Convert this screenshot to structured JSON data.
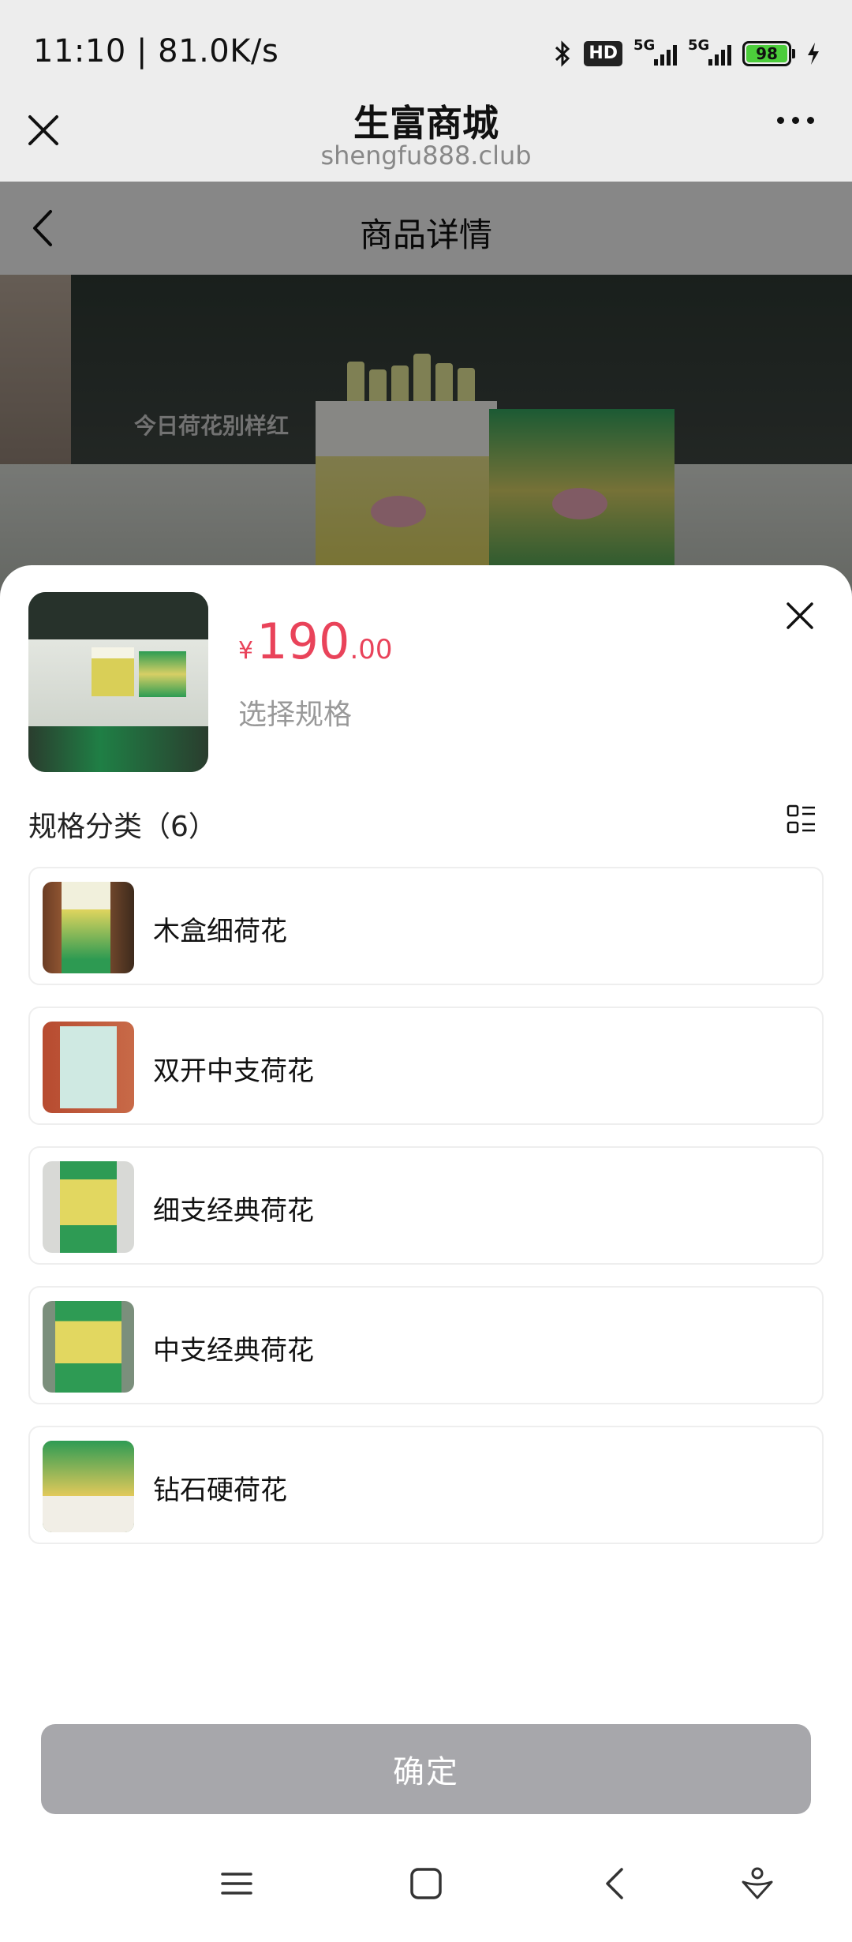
{
  "status_bar": {
    "time_speed": "11:10 | 81.0K/s",
    "hd_label": "HD",
    "signal1_label": "5G",
    "signal2_label": "5G",
    "battery": "98"
  },
  "mini_program": {
    "title": "生富商城",
    "url": "shengfu888.club"
  },
  "page": {
    "title": "商品详情",
    "hero_slogan": "今日荷花别样红"
  },
  "sheet": {
    "price_currency": "¥",
    "price_integer": "190",
    "price_decimal": ".00",
    "spec_hint": "选择规格",
    "section_title": "规格分类（6）",
    "specs": [
      {
        "label": "木盒细荷花"
      },
      {
        "label": "双开中支荷花"
      },
      {
        "label": "细支经典荷花"
      },
      {
        "label": "中支经典荷花"
      },
      {
        "label": "钻石硬荷花"
      }
    ],
    "confirm_label": "确定"
  },
  "colors": {
    "price": "#e9435a",
    "confirm_bg": "#a7a7ab",
    "battery_fill": "#4ccd3b"
  },
  "icons": [
    "bluetooth-icon",
    "close-icon",
    "more-icon",
    "back-icon",
    "grid-toggle-icon",
    "menu-icon",
    "home-icon",
    "system-back-icon",
    "assistant-icon"
  ]
}
